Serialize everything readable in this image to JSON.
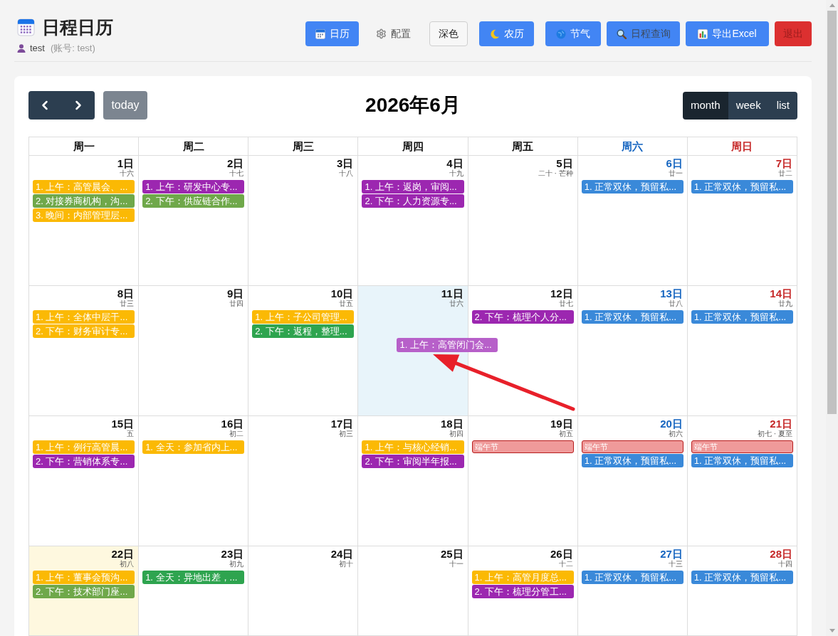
{
  "header": {
    "title": "日程日历",
    "user": "test",
    "account": "(账号: test)",
    "buttons": [
      {
        "label": "日历",
        "kind": "calendar"
      },
      {
        "label": "配置",
        "kind": "settings"
      },
      {
        "label": "深色",
        "kind": "theme"
      },
      {
        "label": "农历",
        "kind": "lunar"
      },
      {
        "label": "节气",
        "kind": "terms"
      },
      {
        "label": "日程查询",
        "kind": "search"
      },
      {
        "label": "导出Excel",
        "kind": "export"
      },
      {
        "label": "退出",
        "kind": "logout"
      }
    ]
  },
  "calendar": {
    "today_button": "today",
    "title": "2026年6月",
    "views": [
      {
        "label": "month",
        "selected": true
      },
      {
        "label": "week",
        "selected": false
      },
      {
        "label": "list",
        "selected": false
      }
    ],
    "weekdays": [
      {
        "label": "周一",
        "kind": "weekday"
      },
      {
        "label": "周二",
        "kind": "weekday"
      },
      {
        "label": "周三",
        "kind": "weekday"
      },
      {
        "label": "周四",
        "kind": "weekday"
      },
      {
        "label": "周五",
        "kind": "weekday"
      },
      {
        "label": "周六",
        "kind": "saturday"
      },
      {
        "label": "周日",
        "kind": "sunday"
      }
    ],
    "weeks": [
      {
        "days": [
          {
            "day": "1日",
            "lunar": "十六",
            "selected": false,
            "today": false,
            "events": [
              {
                "text": "1. 上午：高管晨会、...",
                "kind": "event",
                "color": "#fbb904"
              },
              {
                "text": "2. 对接券商机构，沟...",
                "kind": "event",
                "color": "#6fa84a"
              },
              {
                "text": "3. 晚间：内部管理层...",
                "kind": "event",
                "color": "#fbb904"
              }
            ]
          },
          {
            "day": "2日",
            "lunar": "十七",
            "selected": false,
            "today": false,
            "events": [
              {
                "text": "1. 上午：研发中心专...",
                "kind": "event",
                "color": "#9c27b0"
              },
              {
                "text": "2. 下午：供应链合作...",
                "kind": "event",
                "color": "#6fa84a"
              }
            ]
          },
          {
            "day": "3日",
            "lunar": "十八",
            "selected": false,
            "today": false
          },
          {
            "day": "4日",
            "lunar": "十九",
            "selected": false,
            "today": false,
            "events": [
              {
                "text": "1. 上午：返岗，审阅...",
                "kind": "event",
                "color": "#9c27b0"
              },
              {
                "text": "2. 下午：人力资源专...",
                "kind": "event",
                "color": "#9c27b0"
              }
            ]
          },
          {
            "day": "5日",
            "lunar": "二十 · 芒种",
            "selected": false,
            "today": false
          },
          {
            "day": "6日",
            "lunar": "廿一",
            "selected": false,
            "today": false,
            "events": [
              {
                "text": "1. 正常双休，预留私...",
                "kind": "event",
                "color": "#3a89d9"
              }
            ]
          },
          {
            "day": "7日",
            "lunar": "廿二",
            "selected": false,
            "today": false,
            "events": [
              {
                "text": "1. 正常双休，预留私...",
                "kind": "event",
                "color": "#3a89d9"
              }
            ]
          }
        ]
      },
      {
        "days": [
          {
            "day": "8日",
            "lunar": "廿三",
            "selected": false,
            "today": false,
            "events": [
              {
                "text": "1. 上午：全体中层干...",
                "kind": "event",
                "color": "#fbb904"
              },
              {
                "text": "2. 下午：财务审计专...",
                "kind": "event",
                "color": "#fbb904"
              }
            ]
          },
          {
            "day": "9日",
            "lunar": "廿四",
            "selected": false,
            "today": false
          },
          {
            "day": "10日",
            "lunar": "廿五",
            "selected": false,
            "today": false,
            "events": [
              {
                "text": "1. 上午：子公司管理...",
                "kind": "event",
                "color": "#fbb904"
              },
              {
                "text": "2. 下午：返程，整理...",
                "kind": "event",
                "color": "#2ea44f"
              }
            ]
          },
          {
            "day": "11日",
            "lunar": "廿六",
            "selected": true,
            "today": false,
            "events": [
              {
                "text": "1. 上午：高管闭门会...",
                "kind": "dragging",
                "color": "#b760c9"
              }
            ]
          },
          {
            "day": "12日",
            "lunar": "廿七",
            "selected": false,
            "today": false,
            "events": [
              {
                "text": "2. 下午：梳理个人分...",
                "kind": "event",
                "color": "#9c27b0"
              }
            ]
          },
          {
            "day": "13日",
            "lunar": "廿八",
            "selected": false,
            "today": false,
            "events": [
              {
                "text": "1. 正常双休，预留私...",
                "kind": "event",
                "color": "#3a89d9"
              }
            ]
          },
          {
            "day": "14日",
            "lunar": "廿九",
            "selected": false,
            "today": false,
            "events": [
              {
                "text": "1. 正常双休，预留私...",
                "kind": "event",
                "color": "#3a89d9"
              }
            ]
          }
        ]
      },
      {
        "days": [
          {
            "day": "15日",
            "lunar": "五",
            "selected": false,
            "today": false,
            "events": [
              {
                "text": "1. 上午：例行高管晨...",
                "kind": "event",
                "color": "#fbb904"
              },
              {
                "text": "2. 下午：营销体系专...",
                "kind": "event",
                "color": "#9c27b0"
              }
            ]
          },
          {
            "day": "16日",
            "lunar": "初二",
            "selected": false,
            "today": false,
            "events": [
              {
                "text": "1. 全天：参加省内上...",
                "kind": "event",
                "color": "#fbb904"
              }
            ]
          },
          {
            "day": "17日",
            "lunar": "初三",
            "selected": false,
            "today": false
          },
          {
            "day": "18日",
            "lunar": "初四",
            "selected": false,
            "today": false,
            "events": [
              {
                "text": "1. 上午：与核心经销...",
                "kind": "event",
                "color": "#fbb904"
              },
              {
                "text": "2. 下午：审阅半年报...",
                "kind": "event",
                "color": "#9c27b0"
              }
            ]
          },
          {
            "day": "19日",
            "lunar": "初五",
            "selected": false,
            "today": false,
            "events": [
              {
                "text": "端午节",
                "kind": "holiday",
                "color": "#ef9a9a"
              }
            ]
          },
          {
            "day": "20日",
            "lunar": "初六",
            "selected": false,
            "today": false,
            "events": [
              {
                "text": "端午节",
                "kind": "holiday",
                "color": "#ef9a9a"
              },
              {
                "text": "1. 正常双休，预留私...",
                "kind": "event",
                "color": "#3a89d9"
              }
            ]
          },
          {
            "day": "21日",
            "lunar": "初七 · 夏至",
            "selected": false,
            "today": false,
            "events": [
              {
                "text": "端午节",
                "kind": "holiday",
                "color": "#ef9a9a"
              },
              {
                "text": "1. 正常双休，预留私...",
                "kind": "event",
                "color": "#3a89d9"
              }
            ]
          }
        ]
      },
      {
        "days": [
          {
            "day": "22日",
            "lunar": "初八",
            "selected": false,
            "today": true,
            "events": [
              {
                "text": "1. 上午：董事会预沟...",
                "kind": "event",
                "color": "#fbb904"
              },
              {
                "text": "2. 下午：技术部门座...",
                "kind": "event",
                "color": "#6fa84a"
              }
            ]
          },
          {
            "day": "23日",
            "lunar": "初九",
            "selected": false,
            "today": false,
            "events": [
              {
                "text": "1. 全天：异地出差，...",
                "kind": "event",
                "color": "#2ea44f"
              }
            ]
          },
          {
            "day": "24日",
            "lunar": "初十",
            "selected": false,
            "today": false
          },
          {
            "day": "25日",
            "lunar": "十一",
            "selected": false,
            "today": false
          },
          {
            "day": "26日",
            "lunar": "十二",
            "selected": false,
            "today": false,
            "events": [
              {
                "text": "1. 上午：高管月度总...",
                "kind": "event",
                "color": "#fbb904"
              },
              {
                "text": "2. 下午：梳理分管工...",
                "kind": "event",
                "color": "#9c27b0"
              }
            ]
          },
          {
            "day": "27日",
            "lunar": "十三",
            "selected": false,
            "today": false,
            "events": [
              {
                "text": "1. 正常双休，预留私...",
                "kind": "event",
                "color": "#3a89d9"
              }
            ]
          },
          {
            "day": "28日",
            "lunar": "十四",
            "selected": false,
            "today": false,
            "events": [
              {
                "text": "1. 正常双休，预留私...",
                "kind": "event",
                "color": "#3a89d9"
              }
            ]
          }
        ]
      }
    ]
  }
}
